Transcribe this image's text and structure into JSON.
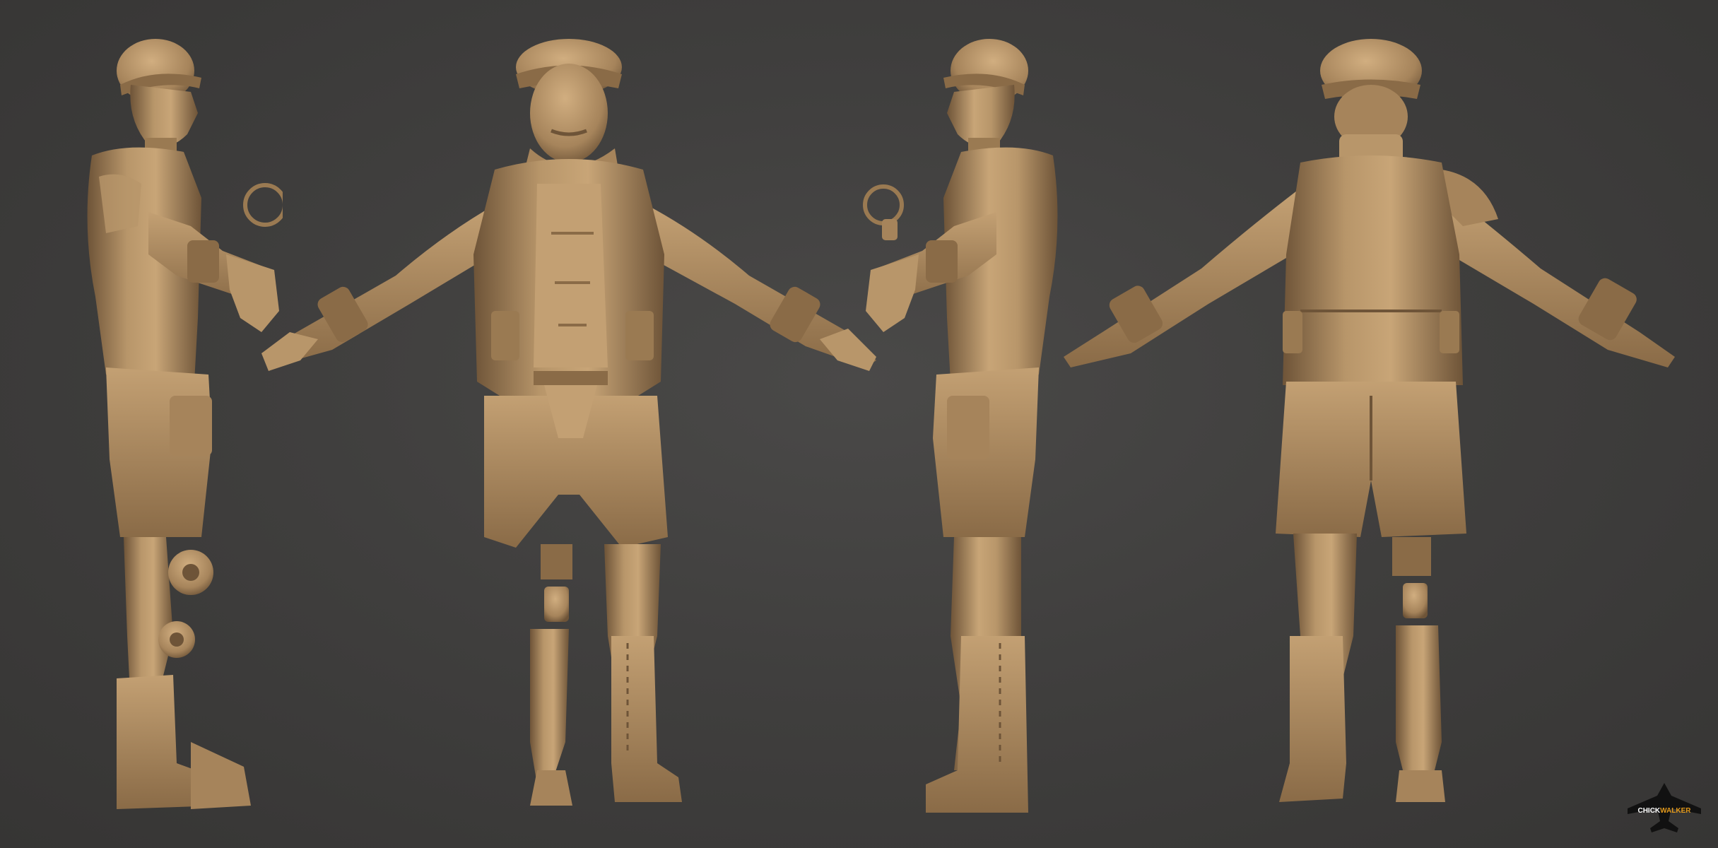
{
  "image": {
    "subject": "sculpt-turnaround",
    "views": [
      {
        "id": "side-right",
        "name": "side-profile-right"
      },
      {
        "id": "front",
        "name": "front"
      },
      {
        "id": "side-left",
        "name": "side-profile-left"
      },
      {
        "id": "back",
        "name": "back"
      }
    ],
    "colors": {
      "background": "#403f3e",
      "clay_light": "#c8a577",
      "clay_mid": "#a6845b",
      "clay_dark": "#6e5438",
      "logo_mark": "#111111",
      "logo_accent": "#e39a1c"
    }
  },
  "watermark": {
    "text_part1": "CHICK",
    "text_part2": "WALKER"
  }
}
